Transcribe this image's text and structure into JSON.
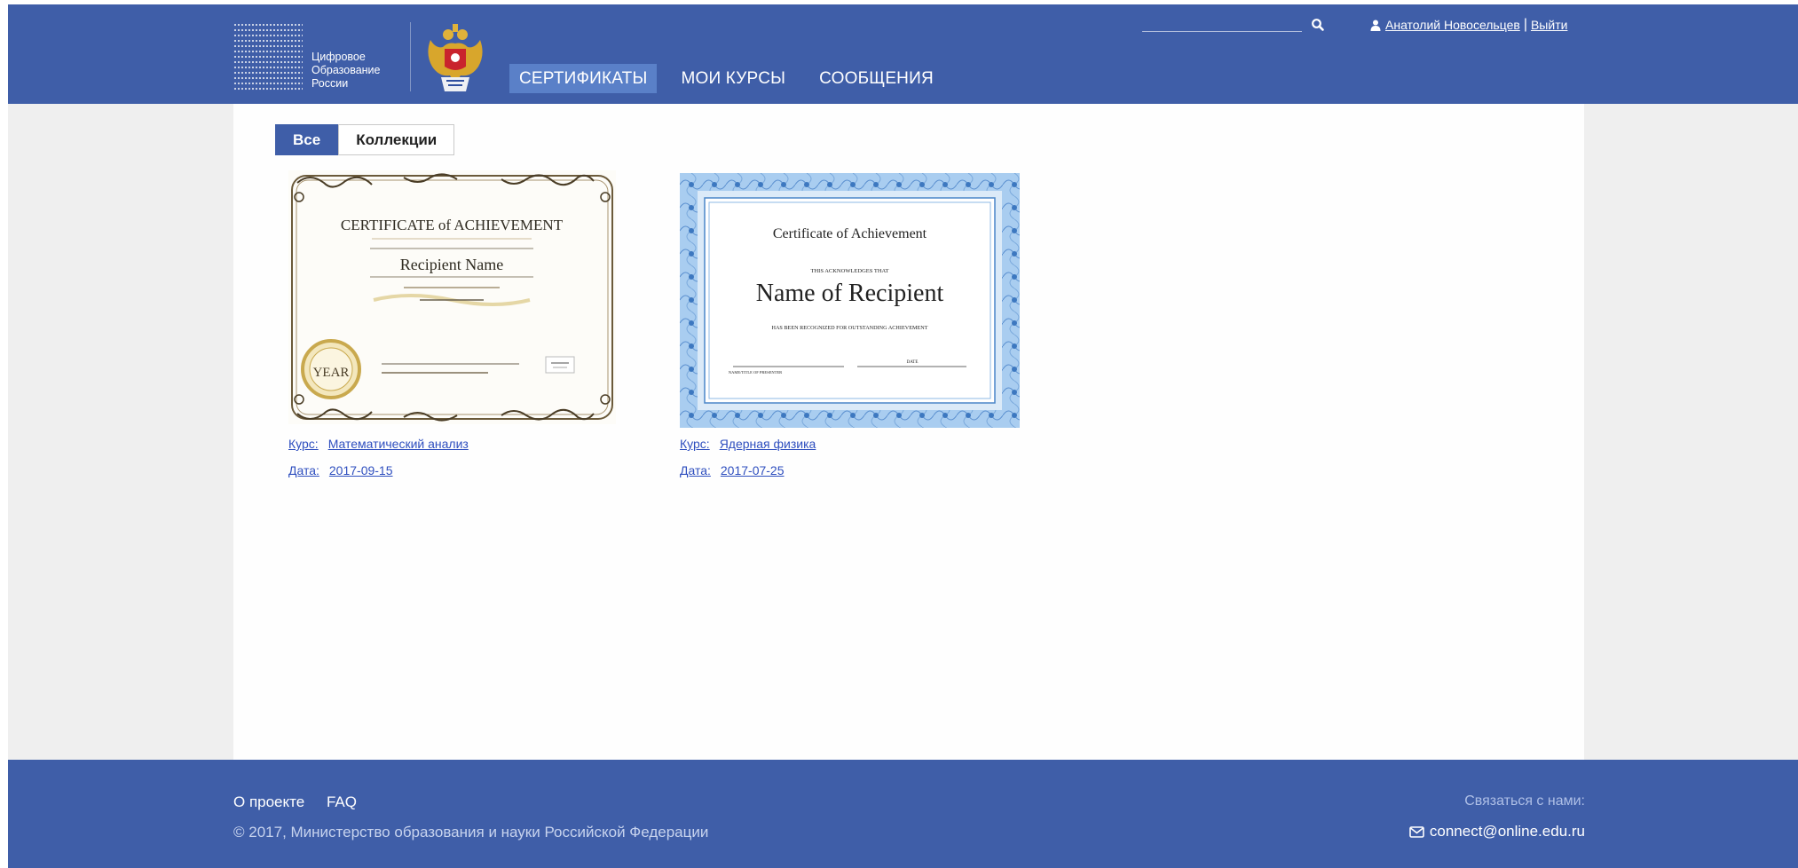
{
  "header": {
    "logo_lines": [
      "Цифровое",
      "Образование",
      "России"
    ],
    "nav": [
      {
        "label": "СЕРТИФИКАТЫ",
        "active": true
      },
      {
        "label": "МОИ КУРСЫ",
        "active": false
      },
      {
        "label": "СООБЩЕНИЯ",
        "active": false
      }
    ],
    "search_value": "",
    "user_name": "Анатолий Новосельцев",
    "logout": "Выйти",
    "separator": "|"
  },
  "tabs": [
    {
      "label": "Все",
      "active": true
    },
    {
      "label": "Коллекции",
      "active": false
    }
  ],
  "certificates": [
    {
      "image": {
        "heading": "CERTIFICATE of ACHIEVEMENT",
        "recipient": "Recipient Name",
        "seal": "YEAR"
      },
      "course_label": "Курс:",
      "course": "Математический анализ",
      "date_label": "Дата:",
      "date": "2017-09-15"
    },
    {
      "image": {
        "heading": "Certificate of Achievement",
        "subheading": "THIS ACKNOWLEDGES THAT",
        "recipient": "Name of Recipient",
        "statement": "HAS BEEN RECOGNIZED FOR OUTSTANDING ACHIEVEMENT",
        "sign_left": "NAME/TITLE OF PRESENTER",
        "sign_right": "DATE"
      },
      "course_label": "Курс:",
      "course": "Ядерная физика",
      "date_label": "Дата:",
      "date": "2017-07-25"
    }
  ],
  "footer": {
    "links": [
      "О проекте",
      "FAQ"
    ],
    "copyright": "© 2017, Министерство образования и науки Российской Федерации",
    "contact_label": "Связаться с нами:",
    "email": "connect@online.edu.ru"
  },
  "colors": {
    "brand_blue": "#3f5ea8",
    "nav_active": "#5a80c8",
    "link": "#2f4fbf"
  }
}
